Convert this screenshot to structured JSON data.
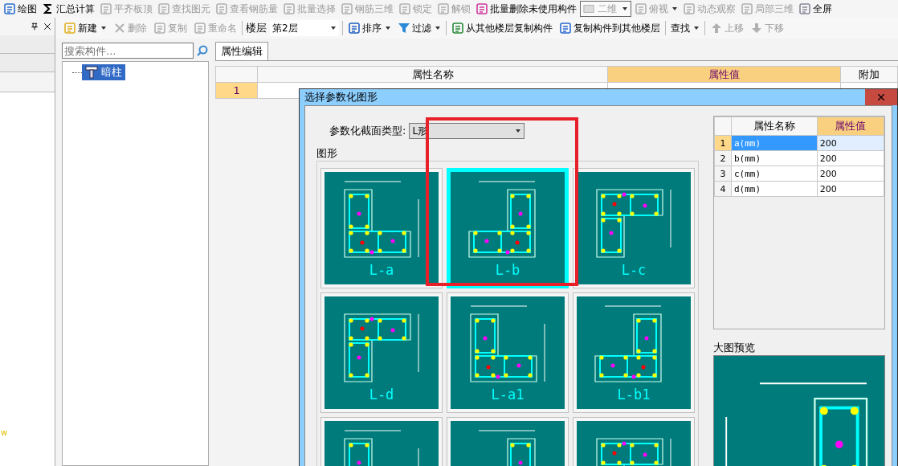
{
  "main_toolbar": [
    {
      "label": "绘图",
      "kind": "button",
      "disabled": false
    },
    {
      "label": "汇总计算",
      "kind": "button",
      "disabled": false
    },
    {
      "label": "平齐板顶",
      "kind": "button",
      "disabled": true
    },
    {
      "label": "查找图元",
      "kind": "button",
      "disabled": true
    },
    {
      "label": "查看钢筋量",
      "kind": "button",
      "disabled": true
    },
    {
      "label": "批量选择",
      "kind": "button",
      "disabled": true
    },
    {
      "label": "钢筋三维",
      "kind": "button",
      "disabled": true
    },
    {
      "label": "锁定",
      "kind": "button",
      "disabled": true
    },
    {
      "label": "解锁",
      "kind": "button",
      "disabled": true
    },
    {
      "label": "批量删除未使用构件",
      "kind": "button",
      "disabled": false
    },
    {
      "label": "二维",
      "kind": "combo",
      "disabled": true
    },
    {
      "label": "俯视",
      "kind": "dropdown",
      "disabled": true
    },
    {
      "label": "动态观察",
      "kind": "button",
      "disabled": true
    },
    {
      "label": "局部三维",
      "kind": "button",
      "disabled": true
    },
    {
      "label": "全屏",
      "kind": "button",
      "disabled": false
    }
  ],
  "component_toolbar": [
    {
      "label": "新建",
      "kind": "dropdown",
      "disabled": false
    },
    {
      "label": "删除",
      "kind": "button",
      "disabled": true
    },
    {
      "label": "复制",
      "kind": "button",
      "disabled": true
    },
    {
      "label": "重命名",
      "kind": "button",
      "disabled": true
    },
    {
      "label": "楼层",
      "kind": "label"
    },
    {
      "label": "第2层",
      "kind": "combo",
      "disabled": false
    },
    {
      "label": "排序",
      "kind": "dropdown",
      "disabled": false
    },
    {
      "label": "过滤",
      "kind": "dropdown",
      "disabled": false
    },
    {
      "label": "从其他楼层复制构件",
      "kind": "button",
      "disabled": false
    },
    {
      "label": "复制构件到其他楼层",
      "kind": "button",
      "disabled": false
    },
    {
      "label": "查找",
      "kind": "dropdown",
      "disabled": false
    },
    {
      "label": "上移",
      "kind": "button",
      "disabled": true
    },
    {
      "label": "下移",
      "kind": "button",
      "disabled": true
    }
  ],
  "left_panel": {
    "marker": "w"
  },
  "component_tree": {
    "search": {
      "placeholder": "搜索构件..."
    },
    "items": [
      {
        "label": "暗柱",
        "selected": true
      }
    ]
  },
  "property_panel": {
    "tabs": [
      {
        "label": "属性编辑",
        "selected": true
      }
    ],
    "columns": [
      {
        "label": "属性名称",
        "selected": false
      },
      {
        "label": "属性值",
        "selected": true
      },
      {
        "label": "附加",
        "selected": false
      }
    ],
    "rows": [
      {
        "number": "1"
      }
    ]
  },
  "dialog": {
    "title": "选择参数化图形",
    "section_type": {
      "label": "参数化截面类型:",
      "value": "L形"
    },
    "group_label": "图形",
    "shapes": [
      {
        "caption": "L-a",
        "selected": false
      },
      {
        "caption": "L-b",
        "selected": true
      },
      {
        "caption": "L-c",
        "selected": false
      },
      {
        "caption": "L-d",
        "selected": false
      },
      {
        "caption": "L-a1",
        "selected": false
      },
      {
        "caption": "L-b1",
        "selected": false
      },
      {
        "selected": false
      },
      {
        "selected": false
      },
      {
        "selected": false
      }
    ],
    "params": {
      "columns": [
        "属性名称",
        "属性值"
      ],
      "rows": [
        {
          "number": "1",
          "name": "a(mm)",
          "value": "200",
          "selected": true
        },
        {
          "number": "2",
          "name": "b(mm)",
          "value": "200",
          "selected": false
        },
        {
          "number": "3",
          "name": "c(mm)",
          "value": "200",
          "selected": false
        },
        {
          "number": "4",
          "name": "d(mm)",
          "value": "200",
          "selected": false
        }
      ]
    },
    "preview_label": "大图预览"
  }
}
